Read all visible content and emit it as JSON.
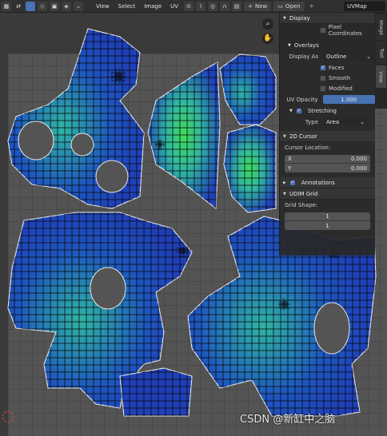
{
  "header": {
    "menus": [
      "View",
      "Select",
      "Image",
      "UV"
    ],
    "new_label": "New",
    "open_label": "Open",
    "image_name": "UVMap"
  },
  "side_tabs": [
    "Image",
    "Tool",
    "View"
  ],
  "panel": {
    "display": {
      "title": "Display",
      "pixel_coordinates": "Pixel Coordinates",
      "overlays_title": "Overlays",
      "display_as_label": "Display As",
      "display_as_value": "Outline",
      "faces": "Faces",
      "smooth": "Smooth",
      "modified": "Modified",
      "uv_opacity_label": "UV Opacity",
      "uv_opacity_value": "1.000",
      "stretching": "Stretching",
      "type_label": "Type",
      "type_value": "Area"
    },
    "cursor": {
      "title": "2D Cursor",
      "location_label": "Cursor Location:",
      "x_label": "X",
      "x_value": "0.000",
      "y_label": "Y",
      "y_value": "0.000"
    },
    "annotations": "Annotations",
    "udim": {
      "title": "UDIM Grid",
      "grid_shape_label": "Grid Shape:",
      "grid_x": "1",
      "grid_y": "1"
    }
  },
  "watermark": "CSDN @新缸中之脑",
  "colors": {
    "accent": "#4772b3",
    "uv_blue": "#1f3fb8",
    "uv_teal": "#2fb6a4",
    "uv_green": "#3fdc5a"
  }
}
